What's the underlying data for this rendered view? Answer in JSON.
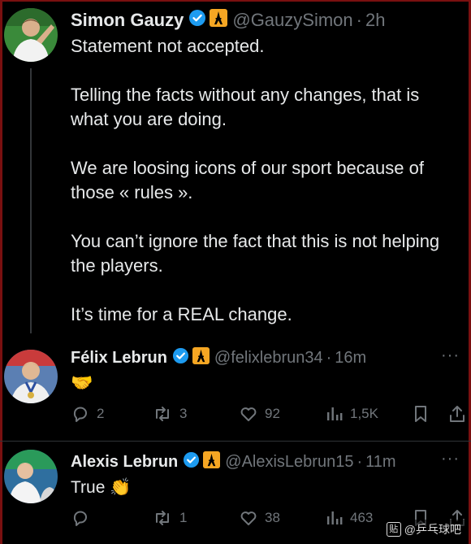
{
  "tweets": [
    {
      "name": "Simon Gauzy",
      "handle": "@GauzySimon",
      "separator": "·",
      "time": "2h",
      "paragraphs": [
        "Statement not accepted.",
        "Telling the facts without any changes, that is what you are doing.",
        "We are loosing icons of our sport because of those « rules ».",
        "You can’t ignore the fact that this is not helping the players.",
        "It’s time for a REAL change."
      ]
    },
    {
      "name": "Félix Lebrun",
      "handle": "@felixlebrun34",
      "separator": "·",
      "time": "16m",
      "text": "🤝",
      "replies": "2",
      "reposts": "3",
      "likes": "92",
      "views": "1,5K"
    },
    {
      "name": "Alexis Lebrun",
      "handle": "@AlexisLebrun15",
      "separator": "·",
      "time": "11m",
      "text": "True 👏",
      "replies": "",
      "reposts": "1",
      "likes": "38",
      "views": "463"
    }
  ],
  "icons": {
    "verified": "verified-badge-icon",
    "flag": "eiffel-tower-icon",
    "more": "more-dots-icon",
    "reply": "reply-icon",
    "repost": "repost-icon",
    "like": "heart-icon",
    "views": "views-icon",
    "bookmark": "bookmark-icon",
    "share": "share-icon"
  },
  "colors": {
    "background": "#000000",
    "text": "#e7e9ea",
    "muted": "#71767b",
    "verified": "#1d9bf0",
    "flag": "#f5a623",
    "frame": "#7a1010"
  },
  "watermark": {
    "badge": "贴",
    "label": "@乒乓球吧"
  },
  "ui": {
    "more_label": "···"
  }
}
